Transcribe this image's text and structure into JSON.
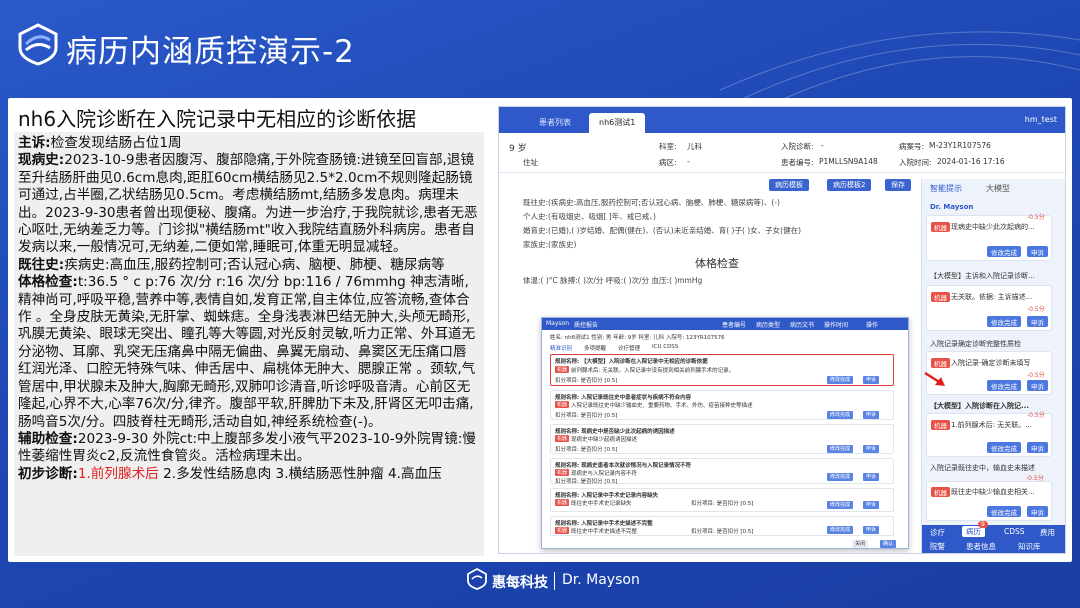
{
  "slide": {
    "title": "病历内涵质控演示-2",
    "subtitle": "nh6入院诊断在入院记录中无相应的诊断依据"
  },
  "record": {
    "complaint_label": "主诉:",
    "complaint_text": "检查发现结肠占位1周",
    "present_label": "现病史:",
    "present_text": "2023-10-9患者因腹泻、腹部隐痛,于外院查肠镜:进镜至回盲部,退镜至升结肠肝曲见0.6cm息肉,距肛60cm横结肠见2.5*2.0cm不规则隆起肠镜可通过,占半圈,乙状结肠见0.5cm。考虑横结肠mt,结肠多发息肉。病理未出。2023-9-30患者曾出现便秘、腹痛。为进一步治疗,于我院就诊,患者无恶心呕吐,无纳差乏力等。门诊拟\"横结肠mt\"收入我院结直肠外科病房。患者自发病以来,一般情况可,无纳差,二便如常,睡眠可,体重无明显减轻。",
    "past_label": "既往史:",
    "past_text": "疾病史:高血压,服药控制可;否认冠心病、脑梗、肺梗、糖尿病等",
    "exam_label": "体格检查:",
    "exam_text": "t:36.5 ° c p:76 次/分 r:16 次/分 bp:116 / 76mmhg 神志清晰,精神尚可,呼吸平稳,营养中等,表情自如,发育正常,自主体位,应答流畅,查体合作 。全身皮肤无黄染,无肝掌、蜘蛛痣。全身浅表淋巴结无肿大,头颅无畸形,巩膜无黄染、眼球无突出、瞳孔等大等圆,对光反射灵敏,听力正常、外耳道无分泌物、耳廓、乳突无压痛鼻中隔无偏曲、鼻翼无扇动、鼻窦区无压痛口唇红润光泽、口腔无特殊气味、伸舌居中、扁桃体无肿大、腮腺正常 。颈软,气管居中,甲状腺未及肿大,胸廓无畸形,双肺叩诊清音,听诊呼吸音清。心前区无隆起,心界不大,心率76次/分,律齐。腹部平软,肝脾肋下未及,肝肾区无叩击痛,肠鸣音5次/分。四肢脊柱无畸形,活动自如,神经系统检查(-)。",
    "aux_label": "辅助检查:",
    "aux_text": "2023-9-30 外院ct:中上腹部多发小液气平2023-10-9外院胃镜:慢性萎缩性胃炎c2,反流性食管炎。活检病理未出。",
    "dx_label": "初步诊断:",
    "dx_1": "1.前列腺术后",
    "dx_rest": "2.多发性结肠息肉 3.横结肠恶性肿瘤 4.高血压"
  },
  "emr": {
    "tabs": [
      "患者列表",
      "nh6测试1"
    ],
    "user": "hm_test",
    "age": "9 岁",
    "address": "住址",
    "dept_label": "科室:",
    "dept": "儿科",
    "ward_label": "病区:",
    "ward": "-",
    "admit_dx_label": "入院诊断:",
    "admit_dx": "-",
    "attending_label": "患者编号:",
    "attending": "P1MLLSN9A148",
    "case_label": "病案号:",
    "case_no": "M-23Y1R107576",
    "doctor_label": "入院时间:",
    "admit_time": "2024-01-16 17:16",
    "doc_lines": [
      "既往史:(疾病史:高血压,服药控制可;否认冠心病、脑梗、肺梗、糖尿病等)、(-)",
      "个人史:(有吸烟史、吸烟[  ]年、戒已戒、)",
      "婚育史:(已婚),(  )岁结婚、配偶(健在)、(否认)未近亲结婚、育(  )子(  )女、子女(健在)",
      "家族史:(家族史)"
    ],
    "exam_heading": "体格检查",
    "vital_line": "体温:(  )°C  脉搏:(  )次/分  呼吸:(  )次/分  血压:(  )mmHg",
    "doc_btn_1": "病历模板",
    "doc_btn_2": "病历模板2",
    "doc_btn_3": "保存",
    "assist_tab_1": "智能提示",
    "assist_tab_2": "大模型",
    "brand": "Dr. Mayson",
    "cards": [
      {
        "chip": "机器",
        "text": "现病史中缺少此次起病的...",
        "score": "-0.5分",
        "btn1": "修改完成",
        "btn2": "申诉"
      },
      {
        "chip": "",
        "text": "【大模型】主诉和入院记录诊断...",
        "score": "",
        "btn1": "",
        "btn2": ""
      },
      {
        "chip": "机器",
        "text": "无关联。依据: 主诉描述...",
        "score": "-0.5分",
        "btn1": "修改完成",
        "btn2": "申诉"
      },
      {
        "chip": "",
        "text": "入院记录确定诊断完整性质检",
        "score": "",
        "btn1": "",
        "btn2": ""
      },
      {
        "chip": "机器",
        "text": "入院记录-确定诊断未填写",
        "score": "-0.5分",
        "btn1": "修改完成",
        "btn2": "申诉"
      },
      {
        "chip": "",
        "text": "【大模型】入院诊断在入院记...",
        "score": "",
        "btn1": "",
        "btn2": ""
      },
      {
        "chip": "机器",
        "text": "1.前列腺术后: 无关联。...",
        "score": "-0.5分",
        "btn1": "修改完成",
        "btn2": "申诉"
      },
      {
        "chip": "",
        "text": "入院记录既往史中，输血史未描述",
        "score": "-0.5分",
        "btn1": "",
        "btn2": ""
      },
      {
        "chip": "机器",
        "text": "既往史中缺少输血史相关...",
        "score": "",
        "btn1": "修改完成",
        "btn2": "申诉"
      }
    ],
    "bottom_tabs": [
      "诊疗",
      "病历",
      "CDSS",
      "费用"
    ],
    "bottom_tabs_2": [
      "院警",
      "患者信息",
      "知识库"
    ],
    "badge": "9",
    "modal": {
      "head": [
        "Mayson",
        "质控报告",
        "患者编号",
        "病历类型",
        "病历文书",
        "操作时间",
        "操作"
      ],
      "name_row": "姓名: nh6测试1   性别: 男   年龄: 9岁   科室: 儿科   入院号: 123YR107576",
      "tabs": [
        "精准识别",
        "多项提醒",
        "诊疗管理",
        "ICU CDSS"
      ],
      "items": [
        {
          "title": "规则名称: 【大模型】入院诊断在入院记录中无相应的诊断依据",
          "chip": "机器",
          "desc": "前列腺术后: 无关联。入院记录中没有提到相关前列腺手术的记录。",
          "score": "扣分项目: 是否扣分 [0.5]",
          "b1": "修改完成",
          "b2": "申诉"
        },
        {
          "title": "规则名称: 入院记录既往史中患者症状与疾病不符合内容",
          "chip": "机器",
          "desc": "入院记录既往史中缺少输血史、重要药物、手术、外伤、疫苗接种史等描述",
          "score": "扣分项目: 是否扣分 [0.5]",
          "b1": "修改完成",
          "b2": "申诉"
        },
        {
          "title": "规则名称: 现病史中是否缺少此次起病的诱因描述",
          "chip": "机器",
          "desc": "现病史中缺少起病诱因描述",
          "score": "扣分项目: 是否扣分 [0.5]",
          "b1": "修改完成",
          "b2": "申诉"
        },
        {
          "title": "规则名称: 现病史患者本次就诊情况与入院记录情况不符",
          "chip": "机器",
          "desc": "现病史与入院记录内容不符",
          "score": "扣分项目: 是否扣分 [0.5]",
          "b1": "修改完成",
          "b2": "申诉"
        },
        {
          "title": "规则名称: 入院记录中手术史记录内容缺失",
          "chip": "机器",
          "desc": "既往史中手术史记录缺失",
          "score": "扣分项目: 是否扣分 [0.5]",
          "b1": "修改完成",
          "b2": "申诉"
        },
        {
          "title": "规则名称: 入院记录中手术史描述不完整",
          "chip": "机器",
          "desc": "既往史中手术史描述不完整",
          "score": "扣分项目: 是否扣分 [0.5]",
          "b1": "修改完成",
          "b2": "申诉"
        }
      ],
      "foot_btn_1": "关闭",
      "foot_btn_2": "确认"
    }
  },
  "footer": {
    "brand_cn": "惠每科技",
    "brand_en": "Dr. Mayson"
  }
}
